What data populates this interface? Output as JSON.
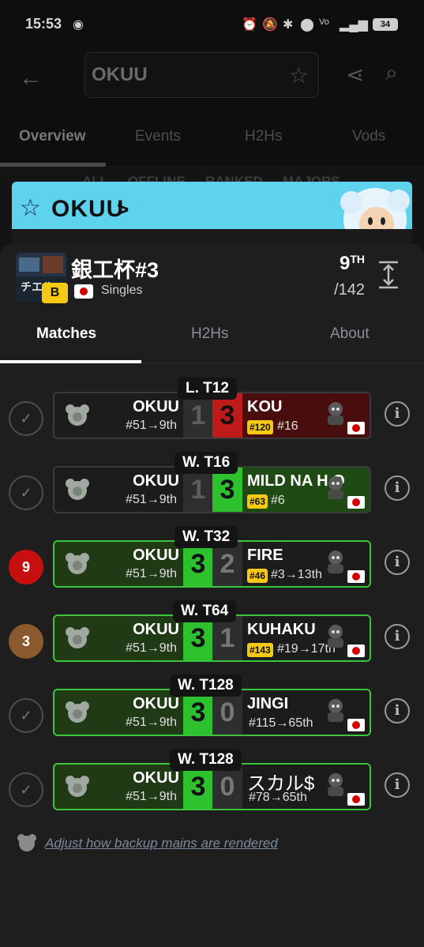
{
  "status_bar": {
    "time": "15:53",
    "battery": "34"
  },
  "search": {
    "query": "OKUU"
  },
  "bg_tabs": [
    "Overview",
    "Events",
    "H2Hs",
    "Vods"
  ],
  "bg_subtabs": [
    "ALL",
    "OFFLINE",
    "RANKED",
    "MAJORS"
  ],
  "banner": {
    "player": "OKUU",
    "chevron": ">"
  },
  "tournament": {
    "name": "銀工杯#3",
    "tier": "B",
    "format": "Singles",
    "placement": "9",
    "placement_suffix": "TH",
    "entrants": "/142"
  },
  "tabs": [
    "Matches",
    "H2Hs",
    "About"
  ],
  "matches": [
    {
      "round": "L. T12",
      "status": "check",
      "p1": "OKUU",
      "p1_seed": "#51→9th",
      "s1": "1",
      "s2": "3",
      "p2": "KOU",
      "p2_rank": "#120",
      "p2_seed": "#16"
    },
    {
      "round": "W. T16",
      "status": "check",
      "p1": "OKUU",
      "p1_seed": "#51→9th",
      "s1": "1",
      "s2": "3",
      "p2": "MILD NA H.O",
      "p2_rank": "#63",
      "p2_seed": "#6"
    },
    {
      "round": "W. T32",
      "status": "9",
      "p1": "OKUU",
      "p1_seed": "#51→9th",
      "s1": "3",
      "s2": "2",
      "p2": "FIRE",
      "p2_rank": "#46",
      "p2_seed": "#3→13th"
    },
    {
      "round": "W. T64",
      "status": "3",
      "p1": "OKUU",
      "p1_seed": "#51→9th",
      "s1": "3",
      "s2": "1",
      "p2": "KUHAKU",
      "p2_rank": "#143",
      "p2_seed": "#19→17th"
    },
    {
      "round": "W. T128",
      "status": "check",
      "p1": "OKUU",
      "p1_seed": "#51→9th",
      "s1": "3",
      "s2": "0",
      "p2": "JINGI",
      "p2_rank": "",
      "p2_seed": "#115→65th"
    },
    {
      "round": "W. T128",
      "status": "check",
      "p1": "OKUU",
      "p1_seed": "#51→9th",
      "s1": "3",
      "s2": "0",
      "p2": "スカル$",
      "p2_rank": "",
      "p2_seed": "#78→65th"
    }
  ],
  "adjust_link": "Adjust how backup mains are rendered",
  "colors": {
    "accent_win": "#2ec12e",
    "accent_loss": "#c01b1b",
    "tier_badge": "#f6c915",
    "banner": "#5fd2ee"
  }
}
